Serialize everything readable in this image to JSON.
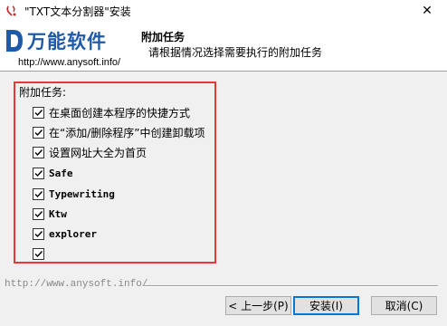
{
  "window": {
    "title": "\"TXT文本分割器\"安装",
    "close_glyph": "✕"
  },
  "header": {
    "logo_text": "万能软件",
    "logo_url": "http://www.anysoft.info/",
    "title": "附加任务",
    "subtitle": "请根据情况选择需要执行的附加任务"
  },
  "tasks": {
    "heading": "附加任务:",
    "items": [
      {
        "label": "在桌面创建本程序的快捷方式",
        "checked": true
      },
      {
        "label": "在“添加/删除程序”中创建卸载项",
        "checked": true
      },
      {
        "label": "设置网址大全为首页",
        "checked": true
      },
      {
        "label": "Safe",
        "checked": true
      },
      {
        "label": "Typewriting",
        "checked": true
      },
      {
        "label": "Ktw",
        "checked": true
      },
      {
        "label": "explorer",
        "checked": true
      },
      {
        "label": "",
        "checked": true
      }
    ]
  },
  "footer": {
    "url": "http://www.anysoft.info/",
    "back_label": "< 上一步(P)",
    "install_label": "安装(I)",
    "cancel_label": "取消(C)"
  },
  "colors": {
    "logo_blue": "#1e5aa8",
    "highlight_border": "#e53935",
    "default_button_border": "#0078d7"
  },
  "icons": {
    "app": "installer-icon",
    "close": "close-icon",
    "checkbox": "checkmark-icon",
    "logo": "logo-d-icon"
  }
}
